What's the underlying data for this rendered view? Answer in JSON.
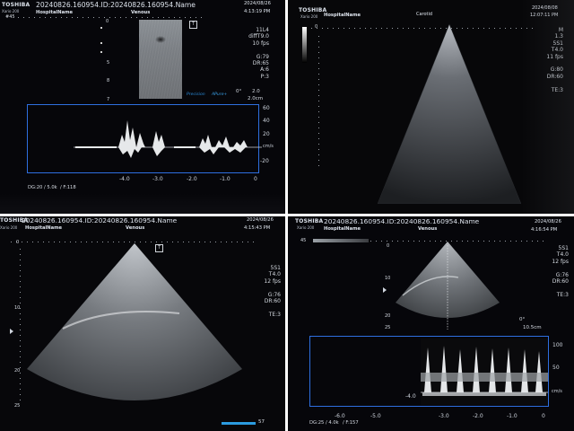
{
  "photos": [
    {
      "brand": "TOSHIBA",
      "model": "Xario 200",
      "patient_line": "20240826.160954.ID:20240826.160954.Name",
      "hospital": "HospitalName",
      "exam": "Venous",
      "date": "2024/08/26",
      "time": "4:13:19 PM",
      "params": [
        "11L4",
        "diffT9.0",
        "10 fps",
        "",
        "G:79",
        "DR:65",
        "A:6",
        "P:3"
      ],
      "mode_text": "Precision",
      "mode_text2": "APure+",
      "angle": "0°",
      "ang2": "2.0",
      "depth": "2.0cm",
      "depth_marks": [
        "0",
        "5",
        "8"
      ],
      "velocity_scale": [
        "60",
        "40",
        "20",
        "cm/s",
        "-20"
      ],
      "time_axis": [
        "-4.0",
        "-3.0",
        "-2.0",
        "-1.0",
        "0"
      ],
      "footer": "DG:20 / 5.0k",
      "footer2": "/ F:118",
      "frame_marker": "7"
    },
    {
      "brand": "TOSHIBA",
      "model": "Xario 200",
      "hospital": "HospitalName",
      "exam": "Carotid",
      "date": "2024/08/08",
      "time": "12:07:11 PM",
      "params": [
        "M",
        "1.3",
        "5S1",
        "T4.0",
        "11 fps",
        "",
        "G:80",
        "DR:60",
        "",
        "TE:3"
      ],
      "depth_marks": [
        "0"
      ]
    },
    {
      "brand": "TOSHIBA",
      "model": "Xario 200",
      "patient_line": "20240826.160954.ID:20240826.160954.Name",
      "hospital": "HospitalName",
      "exam": "Venous",
      "date": "2024/08/26",
      "time": "4:15:43 PM",
      "params": [
        "5S1",
        "T4.0",
        "12 fps",
        "",
        "G:76",
        "DR:60",
        "",
        "TE:3"
      ],
      "depth_marks": [
        "0",
        "10",
        "20",
        "25"
      ],
      "frame_counter": "57"
    },
    {
      "brand": "TOSHIBA",
      "model": "Xario 200",
      "patient_line": "20240826.160954.ID:20240826.160954.Name",
      "hospital": "HospitalName",
      "exam": "Venous",
      "date": "2024/08/26",
      "time": "4:16:54 PM",
      "params": [
        "5S1",
        "T4.0",
        "12 fps",
        "",
        "G:76",
        "DR:60",
        "",
        "TE:3"
      ],
      "gate_label": "45",
      "angle": "0°",
      "depth": "10.5cm",
      "depth_marks": [
        "0",
        "10",
        "20",
        "25"
      ],
      "velocity_scale": [
        "100",
        "50",
        "cm/s"
      ],
      "time_axis": [
        "-6.0",
        "-5.0",
        "-4.0",
        "-3.0",
        "-2.0",
        "-1.0",
        "0"
      ],
      "footer": "DG:25 / 4.0k",
      "footer2": "/ F:157"
    }
  ],
  "colors": {
    "doppler_box": "#2e6fe0",
    "frame_bar": "#2b9bdf",
    "screen": "#050507",
    "bezel": "#121214"
  }
}
